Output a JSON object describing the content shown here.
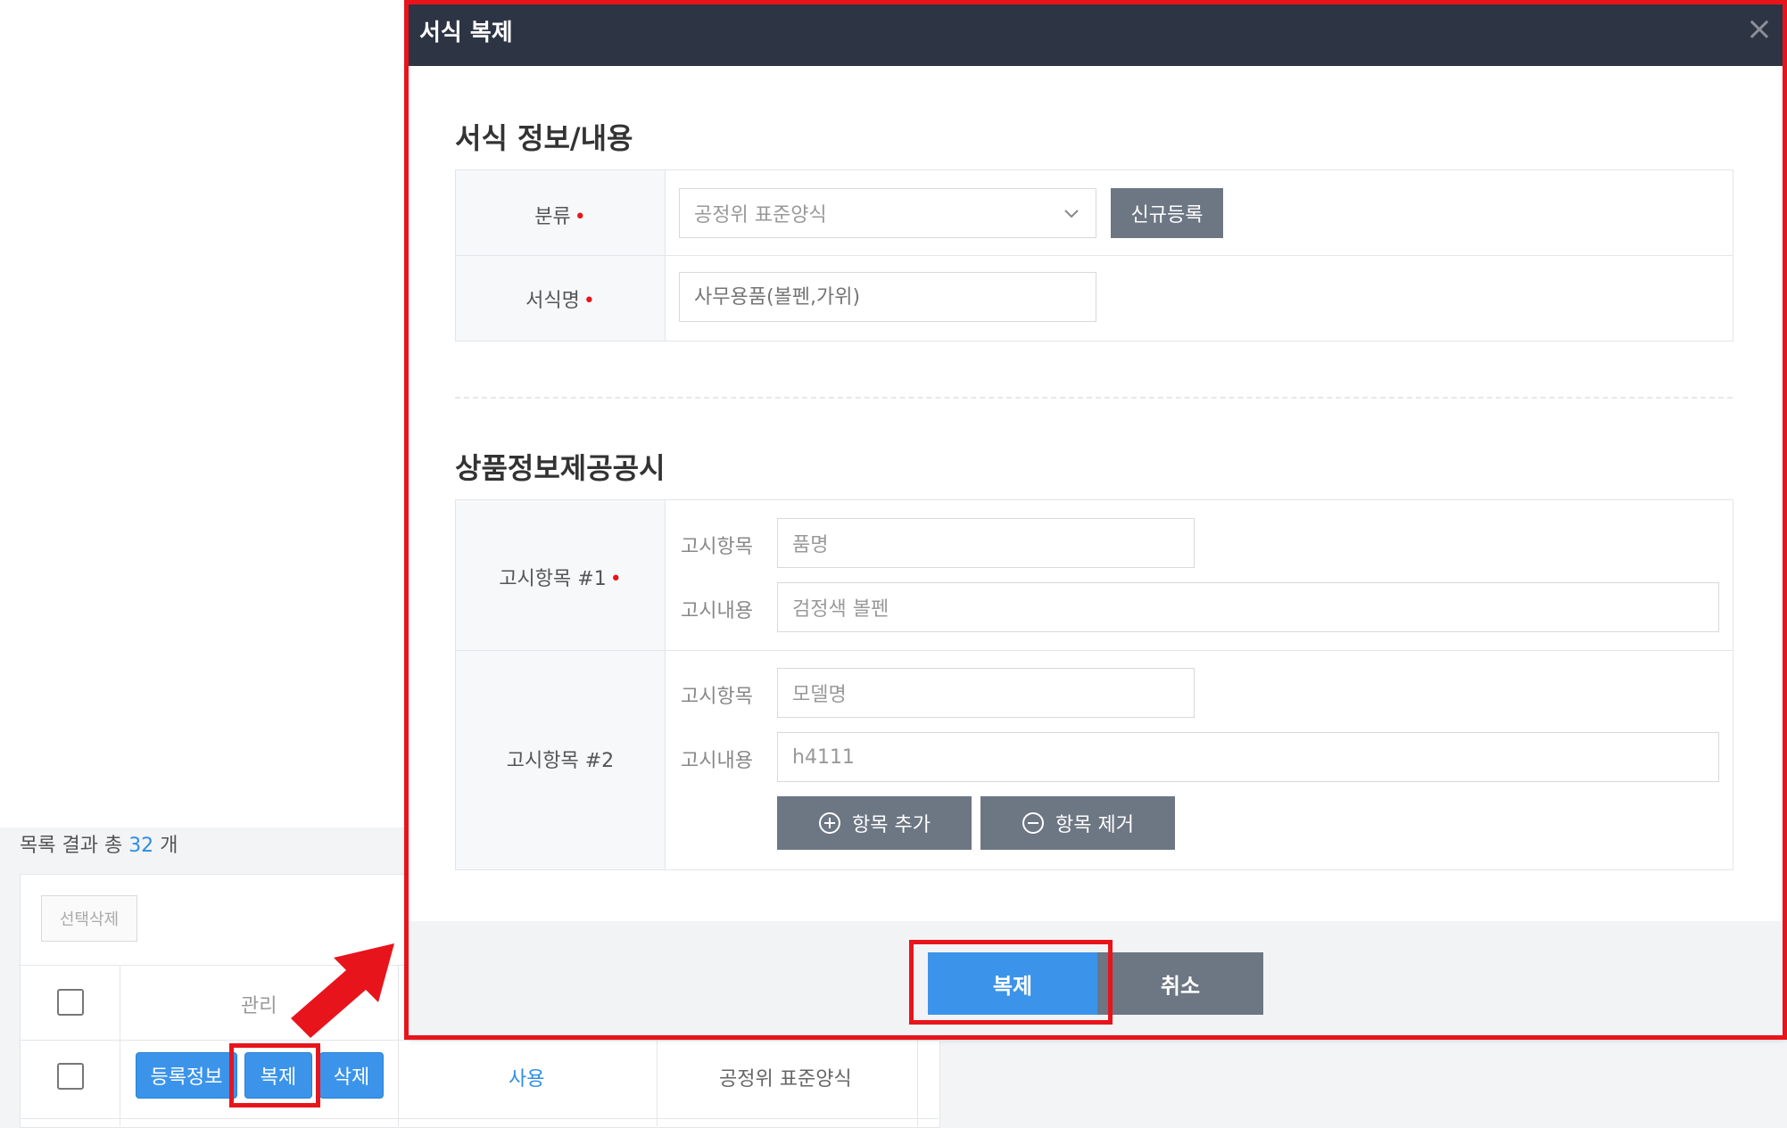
{
  "list": {
    "count_prefix": "목록 결과 총",
    "count_value": "32",
    "count_suffix": "개",
    "select_delete_label": "선택삭제",
    "header_manage": "관리",
    "row": {
      "register_info_label": "등록정보",
      "copy_label": "복제",
      "delete_label": "삭제",
      "status": "사용",
      "category": "공정위 표준양식"
    }
  },
  "modal": {
    "title": "서식 복제",
    "close_icon": "×",
    "section1_title": "서식 정보/내용",
    "category_label": "분류",
    "category_value": "공정위 표준양식",
    "new_register_label": "신규등록",
    "form_name_label": "서식명",
    "form_name_placeholder": "사무용품(볼펜,가위)",
    "section2_title": "상품정보제공공시",
    "item1": {
      "label": "고시항목 #1",
      "item_label": "고시항목",
      "item_value": "품명",
      "content_label": "고시내용",
      "content_value": "검정색 볼펜"
    },
    "item2": {
      "label": "고시항목 #2",
      "item_label": "고시항목",
      "item_value": "모델명",
      "content_label": "고시내용",
      "content_value": "h4111"
    },
    "add_item_label": "항목 추가",
    "remove_item_label": "항목 제거",
    "copy_button_label": "복제",
    "cancel_button_label": "취소"
  },
  "colors": {
    "accent_blue": "#3b94ea",
    "header_dark": "#2d3444",
    "highlight_red": "#e8141c",
    "gray_button": "#6d7683"
  }
}
